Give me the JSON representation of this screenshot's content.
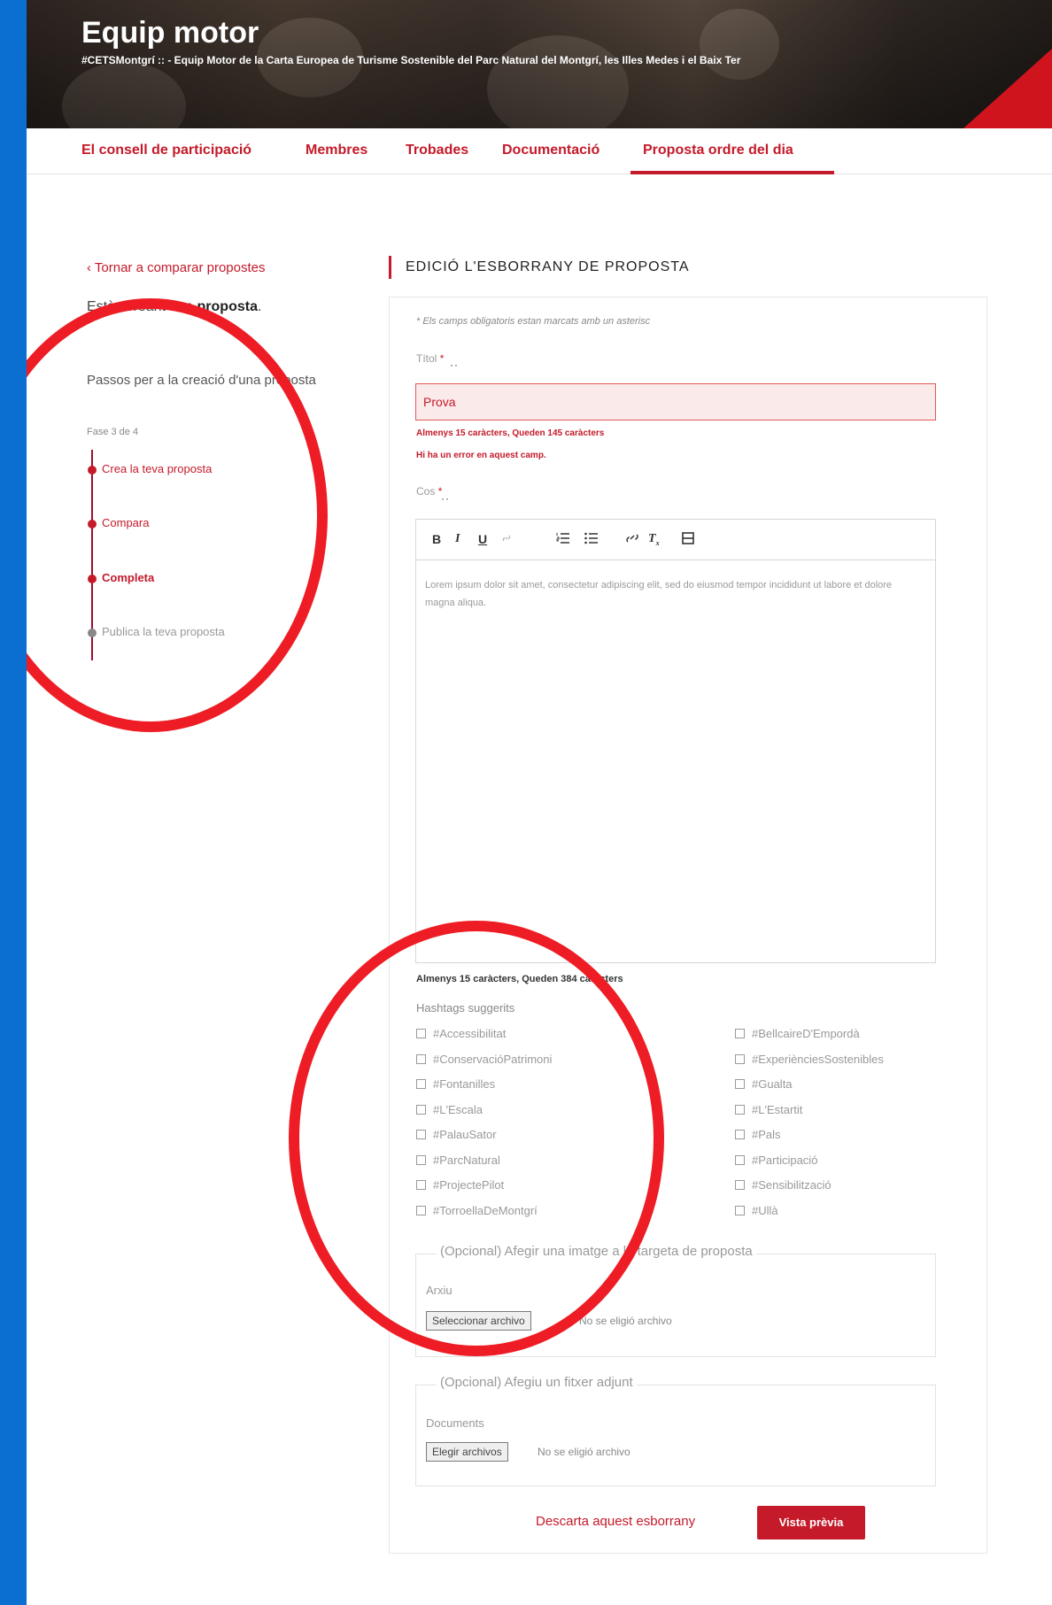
{
  "header": {
    "title": "Equip motor",
    "subtitle": "#CETSMontgrí :: - Equip Motor de la Carta Europea de Turisme Sostenible del Parc Natural del Montgrí, les Illes Medes i el Baix Ter"
  },
  "nav": {
    "items": [
      {
        "label": "El consell de participació"
      },
      {
        "label": "Membres"
      },
      {
        "label": "Trobades"
      },
      {
        "label": "Documentació"
      },
      {
        "label": "Proposta ordre del dia"
      }
    ],
    "active_index": 4
  },
  "sidebar": {
    "back_label": "‹ Tornar a comparar propostes",
    "creating_prefix": "Estàs creant una",
    "creating_bold": "proposta",
    "steps_title": "Passos per a la creació d'una proposta",
    "phase": "Fase 3 de 4",
    "steps": [
      {
        "label": "Crea la teva proposta"
      },
      {
        "label": "Compara"
      },
      {
        "label": "Completa"
      },
      {
        "label": "Publica la teva proposta"
      }
    ],
    "active_step_index": 2
  },
  "form": {
    "section_title": "EDICIÓ L'ESBORRANY DE PROPOSTA",
    "required_note": "* Els camps obligatoris estan marcats amb un asterisc",
    "title_label": "Títol",
    "title_value": "Prova",
    "title_counter": "Almenys 15 caràcters, Queden 145 caràcters",
    "title_error": "Hi ha un error en aquest camp.",
    "body_label": "Cos",
    "body_text": "Lorem ipsum dolor sit amet, consectetur adipiscing elit, sed do eiusmod tempor incididunt ut labore et dolore magna aliqua.",
    "body_counter": "Almenys 15 caràcters, Queden 384 caràcters",
    "toolbar": {
      "bold": "B",
      "italic": "I",
      "underline": "U",
      "link_icon": "link-icon",
      "ordered_list_icon": "ordered-list-icon",
      "bullet_list_icon": "bullet-list-icon",
      "unlink_icon": "unlink-icon",
      "clear_format_icon": "clear-format-icon",
      "video_icon": "video-icon"
    },
    "hashtags_title": "Hashtags suggerits",
    "hashtags_left": [
      "#Accessibilitat",
      "#ConservacióPatrimoni",
      "#Fontanilles",
      "#L'Escala",
      "#PalauSator",
      "#ParcNatural",
      "#ProjectePilot",
      "#TorroellaDeMontgrí"
    ],
    "hashtags_right": [
      "#BellcaireD'Empordà",
      "#ExperiènciesSostenibles",
      "#Gualta",
      "#L'Estartit",
      "#Pals",
      "#Participació",
      "#Sensibilització",
      "#Ullà"
    ],
    "image_legend": "(Opcional) Afegir una imatge a la targeta de proposta",
    "image_field_label": "Arxiu",
    "image_button": "Seleccionar archivo",
    "image_status": "No se eligió archivo",
    "attachment_legend": "(Opcional) Afegiu un fitxer adjunt",
    "attachment_field_label": "Documents",
    "attachment_button": "Elegir archivos",
    "attachment_status": "No se eligió archivo",
    "discard_label": "Descarta aquest esborrany",
    "preview_label": "Vista prèvia"
  },
  "colors": {
    "accent": "#c41a2a",
    "page_background": "#0a6fd0",
    "annotation_circle": "#ee1c24"
  }
}
